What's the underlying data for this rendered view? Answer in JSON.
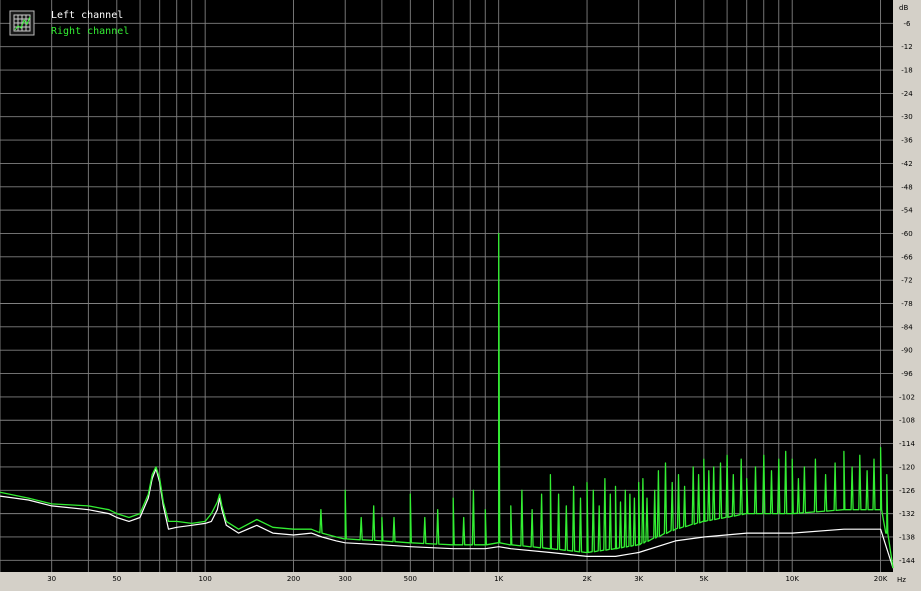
{
  "chart_data": {
    "type": "line",
    "title": "",
    "xlabel": "",
    "ylabel": "",
    "x_unit": "Hz",
    "y_unit": "dB",
    "x_scale": "log",
    "xlim": [
      20,
      22050
    ],
    "ylim": [
      -147,
      0
    ],
    "grid": true,
    "legend_position": "top-left",
    "background": "#000000",
    "grid_color": "#808080",
    "x_ticks": [
      {
        "value": 30,
        "label": "30"
      },
      {
        "value": 50,
        "label": "50"
      },
      {
        "value": 100,
        "label": "100"
      },
      {
        "value": 200,
        "label": "200"
      },
      {
        "value": 300,
        "label": "300"
      },
      {
        "value": 500,
        "label": "500"
      },
      {
        "value": 1000,
        "label": "1K"
      },
      {
        "value": 2000,
        "label": "2K"
      },
      {
        "value": 3000,
        "label": "3K"
      },
      {
        "value": 5000,
        "label": "5K"
      },
      {
        "value": 10000,
        "label": "10K"
      },
      {
        "value": 20000,
        "label": "20K"
      }
    ],
    "y_ticks": [
      {
        "value": -6,
        "label": "-6"
      },
      {
        "value": -12,
        "label": "-12"
      },
      {
        "value": -18,
        "label": "-18"
      },
      {
        "value": -24,
        "label": "-24"
      },
      {
        "value": -30,
        "label": "-30"
      },
      {
        "value": -36,
        "label": "-36"
      },
      {
        "value": -42,
        "label": "-42"
      },
      {
        "value": -48,
        "label": "-48"
      },
      {
        "value": -54,
        "label": "-54"
      },
      {
        "value": -60,
        "label": "-60"
      },
      {
        "value": -66,
        "label": "-66"
      },
      {
        "value": -72,
        "label": "-72"
      },
      {
        "value": -78,
        "label": "-78"
      },
      {
        "value": -84,
        "label": "-84"
      },
      {
        "value": -90,
        "label": "-90"
      },
      {
        "value": -96,
        "label": "-96"
      },
      {
        "value": -102,
        "label": "-102"
      },
      {
        "value": -108,
        "label": "-108"
      },
      {
        "value": -114,
        "label": "-114"
      },
      {
        "value": -120,
        "label": "-120"
      },
      {
        "value": -126,
        "label": "-126"
      },
      {
        "value": -132,
        "label": "-132"
      },
      {
        "value": -138,
        "label": "-138"
      },
      {
        "value": -144,
        "label": "-144"
      }
    ],
    "series": [
      {
        "name": "Left channel",
        "color": "#ffffff",
        "points": [
          [
            20,
            -127.5
          ],
          [
            25,
            -128.5
          ],
          [
            30,
            -130
          ],
          [
            40,
            -131
          ],
          [
            47,
            -132
          ],
          [
            50,
            -133
          ],
          [
            55,
            -134
          ],
          [
            60,
            -133
          ],
          [
            64,
            -128
          ],
          [
            66,
            -123
          ],
          [
            68,
            -120.5
          ],
          [
            70,
            -124
          ],
          [
            72,
            -130
          ],
          [
            75,
            -136
          ],
          [
            80,
            -135.5
          ],
          [
            90,
            -135
          ],
          [
            100,
            -134.5
          ],
          [
            105,
            -134
          ],
          [
            110,
            -131
          ],
          [
            112,
            -128
          ],
          [
            114,
            -131
          ],
          [
            118,
            -135
          ],
          [
            130,
            -137
          ],
          [
            150,
            -135
          ],
          [
            170,
            -137
          ],
          [
            200,
            -137.5
          ],
          [
            230,
            -137
          ],
          [
            250,
            -138
          ],
          [
            280,
            -139
          ],
          [
            300,
            -139.5
          ],
          [
            400,
            -140
          ],
          [
            500,
            -140.5
          ],
          [
            700,
            -141
          ],
          [
            900,
            -141
          ],
          [
            1000,
            -140.5
          ],
          [
            1100,
            -141
          ],
          [
            1500,
            -142
          ],
          [
            2000,
            -143
          ],
          [
            2500,
            -143
          ],
          [
            3000,
            -142
          ],
          [
            4000,
            -139
          ],
          [
            5000,
            -138
          ],
          [
            7000,
            -137
          ],
          [
            10000,
            -137
          ],
          [
            15000,
            -136
          ],
          [
            20000,
            -136
          ],
          [
            21000,
            -141
          ],
          [
            22050,
            -146
          ]
        ]
      },
      {
        "name": "Right channel",
        "color": "#33ee33",
        "points": [
          [
            20,
            -126.5
          ],
          [
            25,
            -128
          ],
          [
            30,
            -129.5
          ],
          [
            40,
            -130
          ],
          [
            47,
            -131
          ],
          [
            50,
            -132
          ],
          [
            55,
            -133
          ],
          [
            60,
            -132
          ],
          [
            64,
            -127
          ],
          [
            66,
            -122
          ],
          [
            68,
            -120
          ],
          [
            70,
            -123
          ],
          [
            72,
            -129
          ],
          [
            75,
            -134
          ],
          [
            80,
            -134
          ],
          [
            90,
            -134.5
          ],
          [
            100,
            -134
          ],
          [
            105,
            -132
          ],
          [
            110,
            -129
          ],
          [
            112,
            -127
          ],
          [
            114,
            -130
          ],
          [
            118,
            -134
          ],
          [
            130,
            -136
          ],
          [
            150,
            -133.5
          ],
          [
            170,
            -135.5
          ],
          [
            200,
            -136
          ],
          [
            230,
            -136
          ],
          [
            250,
            -137
          ],
          [
            280,
            -138
          ],
          [
            300,
            -138.5
          ],
          [
            400,
            -139
          ],
          [
            500,
            -139.5
          ],
          [
            700,
            -140
          ],
          [
            900,
            -140
          ],
          [
            1000,
            -139.5
          ],
          [
            1100,
            -140
          ],
          [
            1500,
            -141
          ],
          [
            2000,
            -142
          ],
          [
            2500,
            -141
          ],
          [
            3000,
            -140
          ],
          [
            4000,
            -136
          ],
          [
            5000,
            -134
          ],
          [
            7000,
            -132
          ],
          [
            10000,
            -132
          ],
          [
            15000,
            -131
          ],
          [
            20000,
            -131
          ],
          [
            21000,
            -137
          ],
          [
            22050,
            -146
          ]
        ],
        "peaks": [
          [
            248,
            -131
          ],
          [
            300,
            -126
          ],
          [
            340,
            -133
          ],
          [
            375,
            -130
          ],
          [
            400,
            -133
          ],
          [
            440,
            -133
          ],
          [
            500,
            -127
          ],
          [
            560,
            -133
          ],
          [
            620,
            -131
          ],
          [
            700,
            -128
          ],
          [
            760,
            -133
          ],
          [
            820,
            -126
          ],
          [
            900,
            -131
          ],
          [
            1000,
            -60
          ],
          [
            1100,
            -130
          ],
          [
            1200,
            -126
          ],
          [
            1300,
            -131
          ],
          [
            1400,
            -127
          ],
          [
            1500,
            -122
          ],
          [
            1600,
            -127
          ],
          [
            1700,
            -130
          ],
          [
            1800,
            -125
          ],
          [
            1900,
            -128
          ],
          [
            2000,
            -124
          ],
          [
            2100,
            -126
          ],
          [
            2200,
            -130
          ],
          [
            2300,
            -123
          ],
          [
            2400,
            -127
          ],
          [
            2500,
            -125
          ],
          [
            2600,
            -129
          ],
          [
            2700,
            -126
          ],
          [
            2800,
            -127
          ],
          [
            2900,
            -128
          ],
          [
            3000,
            -124
          ],
          [
            3100,
            -123
          ],
          [
            3200,
            -128
          ],
          [
            3400,
            -126
          ],
          [
            3500,
            -121
          ],
          [
            3700,
            -119
          ],
          [
            3900,
            -124
          ],
          [
            4100,
            -122
          ],
          [
            4300,
            -125
          ],
          [
            4600,
            -120
          ],
          [
            4800,
            -122
          ],
          [
            5000,
            -118
          ],
          [
            5200,
            -121
          ],
          [
            5400,
            -120
          ],
          [
            5700,
            -119
          ],
          [
            6000,
            -117
          ],
          [
            6300,
            -122
          ],
          [
            6700,
            -118
          ],
          [
            7000,
            -123
          ],
          [
            7500,
            -120
          ],
          [
            8000,
            -117
          ],
          [
            8500,
            -121
          ],
          [
            9000,
            -118
          ],
          [
            9500,
            -116
          ],
          [
            10000,
            -118
          ],
          [
            10500,
            -123
          ],
          [
            11000,
            -120
          ],
          [
            12000,
            -118
          ],
          [
            13000,
            -122
          ],
          [
            14000,
            -119
          ],
          [
            15000,
            -116
          ],
          [
            16000,
            -120
          ],
          [
            17000,
            -117
          ],
          [
            18000,
            -121
          ],
          [
            19000,
            -118
          ],
          [
            20000,
            -115
          ],
          [
            21000,
            -122
          ]
        ]
      }
    ]
  }
}
